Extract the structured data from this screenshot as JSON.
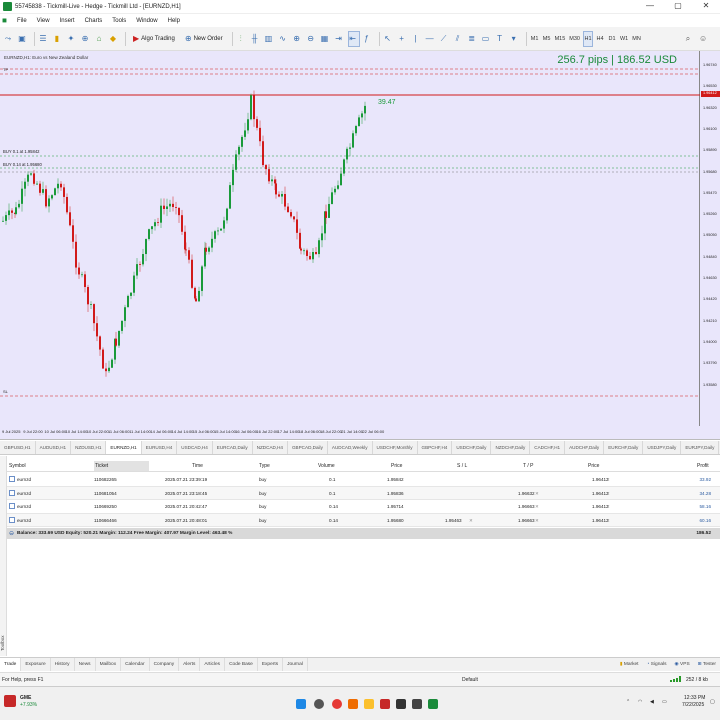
{
  "window": {
    "title": "55745838 - Tickmill-Live - Hedge - Tickmill Ltd - [EURNZD,H1]",
    "minimize": "—",
    "maximize": "▢",
    "close": "✕"
  },
  "menu": [
    "File",
    "View",
    "Insert",
    "Charts",
    "Tools",
    "Window",
    "Help"
  ],
  "toolbar": {
    "algo_trading": "Algo Trading",
    "new_order": "New Order",
    "timeframes": [
      "M1",
      "M5",
      "M15",
      "M30",
      "H1",
      "H4",
      "D1",
      "W1",
      "MN"
    ],
    "active_timeframe": "H1"
  },
  "chart": {
    "symbol_desc": "EURNZD,H1: Euro vs New Zealand Dollar",
    "pips_summary": "256.7 pips | 186.52 USD",
    "current_label": "39.47",
    "order_labels": [
      "BUY 0.1 at 1.95842",
      "BUY 0.14 at 1.95680"
    ],
    "price_levels": [
      "1.96740",
      "1.96530",
      "1.96320",
      "1.96100",
      "1.95890",
      "1.95680",
      "1.95470",
      "1.95260",
      "1.95050",
      "1.94840",
      "1.94630",
      "1.94420",
      "1.94210",
      "1.94000",
      "1.93790",
      "1.93580"
    ],
    "time_labels": [
      "9 Jul 2025",
      "9 Jul 22:00",
      "10 Jul 06:00",
      "10 Jul 14:00",
      "10 Jul 22:00",
      "11 Jul 06:00",
      "11 Jul 14:00",
      "14 Jul 06:00",
      "14 Jul 14:00",
      "15 Jul 06:00",
      "15 Jul 14:00",
      "16 Jul 06:00",
      "16 Jul 22:00",
      "17 Jul 14:00",
      "18 Jul 06:00",
      "18 Jul 22:00",
      "21 Jul 14:00",
      "22 Jul 06:00"
    ],
    "colors": {
      "bull": "#1a9a3a",
      "bear": "#d11a1a",
      "bg": "#e9e6fb"
    }
  },
  "chart_tabs": [
    "GBPUSD,H1",
    "AUDUSD,H1",
    "NZDUSD,H1",
    "EURUSD,H4",
    "USDCAD,H4",
    "EURCAD,Daily",
    "NZDCAD,H4",
    "GBPCAD,Daily",
    "AUDCAD,Weekly",
    "USDCHF,Monthly",
    "GBPCHF,H4",
    "USDCHF,Daily",
    "NZDCHF,Daily",
    "CADCHF,H1",
    "AUDCHF,Daily",
    "EURCHF,Daily",
    "USDJPY,Daily",
    "EURJPY,Daily",
    "NZDJPY,Daily",
    "CADJPY,Dail"
  ],
  "active_chart_tab": "EURNZD,H1",
  "trade": {
    "headers": [
      "Symbol",
      "Ticket",
      "Time",
      "Type",
      "Volume",
      "Price",
      "S / L",
      "T / P",
      "Price",
      "Profit"
    ],
    "rows": [
      {
        "symbol": "eurnzd",
        "ticket": "110682265",
        "time": "2025.07.21 23:39:19",
        "type": "buy",
        "volume": "0.1",
        "price": "1.95842",
        "sl": "",
        "tp": "",
        "current": "1.96412",
        "profit": "33.92"
      },
      {
        "symbol": "eurnzd",
        "ticket": "110681054",
        "time": "2025.07.21 23:18:45",
        "type": "buy",
        "volume": "0.1",
        "price": "1.95836",
        "sl": "",
        "tp": "1.96632",
        "current": "1.96412",
        "profit": "34.28"
      },
      {
        "symbol": "eurnzd",
        "ticket": "110669250",
        "time": "2025.07.21 20:42:47",
        "type": "buy",
        "volume": "0.14",
        "price": "1.95714",
        "sl": "",
        "tp": "1.96663",
        "current": "1.96412",
        "profit": "58.16"
      },
      {
        "symbol": "eurnzd",
        "ticket": "110666466",
        "time": "2025.07.21 20:48:01",
        "type": "buy",
        "volume": "0.14",
        "price": "1.95680",
        "sl": "1.95463",
        "tp": "1.96663",
        "current": "1.96412",
        "profit": "60.16"
      }
    ],
    "balance_line": "Balance: 333.69 USD  Equity: 520.21  Margin: 112.24  Free Margin: 407.97  Margin Level: 463.48 %",
    "total_profit": "186.52"
  },
  "toolbox_label": "Toolbox",
  "bottom_tabs": [
    "Trade",
    "Exposure",
    "History",
    "News",
    "Mailbox",
    "Calendar",
    "Company",
    "Alerts",
    "Articles",
    "Code Base",
    "Experts",
    "Journal"
  ],
  "bottom_right": [
    "Market",
    "Signals",
    "VPS",
    "Tester"
  ],
  "status": {
    "help": "For Help, press F1",
    "profile": "Default",
    "traffic": "252 / 8 kb"
  },
  "taskbar": {
    "stock_name": "GME",
    "stock_change": "+7.93%",
    "time": "12:33 PM",
    "date": "7/22/2025"
  }
}
